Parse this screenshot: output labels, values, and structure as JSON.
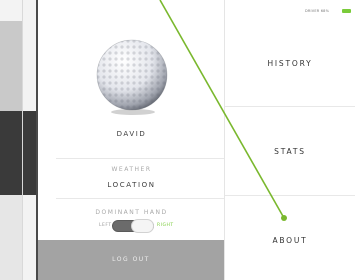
{
  "status_bar": {
    "text": "DRIVER 68%",
    "battery_icon": "battery-icon",
    "battery_color": "#7acb3a"
  },
  "profile": {
    "avatar_icon": "golf-ball-icon",
    "name": "DAVID",
    "weather_label": "WEATHER",
    "location_value": "LOCATION",
    "dominant_hand_label": "DOMINANT HAND",
    "hand_left_label": "LEFT",
    "hand_right_label": "RIGHT",
    "hand_selected": "RIGHT",
    "logout_label": "LOG OUT"
  },
  "menu": {
    "items": [
      {
        "label": "HISTORY"
      },
      {
        "label": "STATS"
      },
      {
        "label": "ABOUT"
      }
    ]
  },
  "colors": {
    "accent": "#7acb3a",
    "pointer_line": "#7ab82e",
    "logout_bg": "#a3a3a3",
    "strip_dark": "#3a3a3a"
  }
}
